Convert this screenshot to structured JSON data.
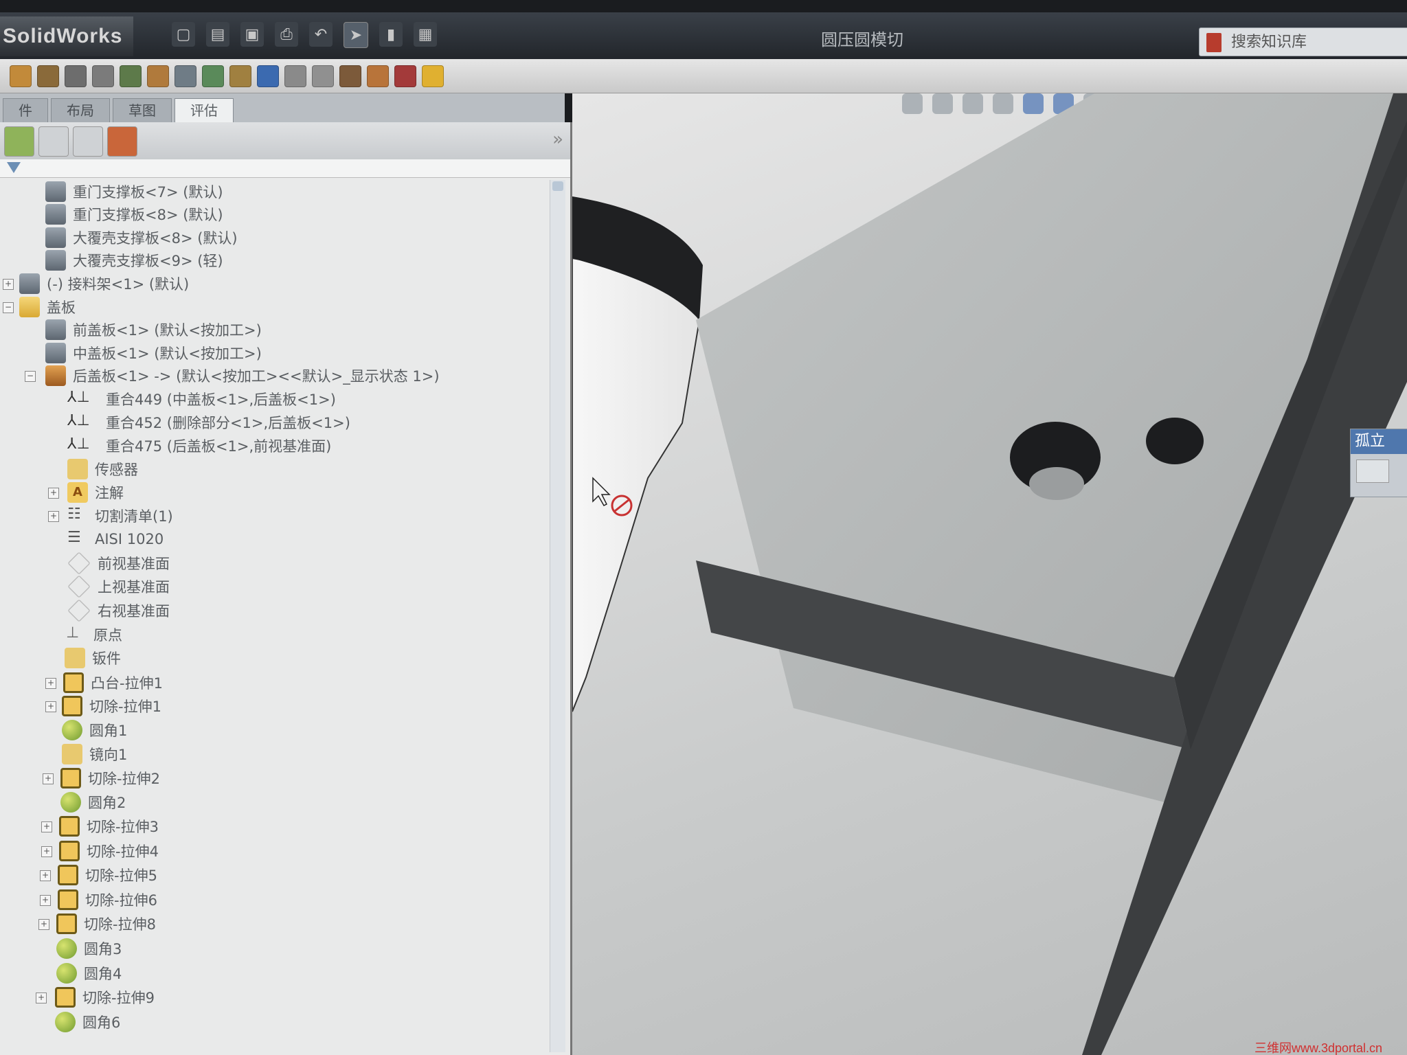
{
  "app": {
    "logo": "SolidWorks",
    "document_title": "圆压圆模切",
    "search_placeholder": "搜索知识库"
  },
  "tabs": [
    {
      "label": "件"
    },
    {
      "label": "布局"
    },
    {
      "label": "草图"
    },
    {
      "label": "评估"
    }
  ],
  "tree": [
    {
      "label": "重门支撑板<7> (默认)",
      "icon": "assembly-icon"
    },
    {
      "label": "重门支撑板<8> (默认)",
      "icon": "assembly-icon"
    },
    {
      "label": "大覆壳支撑板<8> (默认)",
      "icon": "assembly-icon"
    },
    {
      "label": "大覆壳支撑板<9> (轻)",
      "icon": "assembly-icon"
    },
    {
      "label": "(-) 接料架<1> (默认)",
      "icon": "assembly-icon"
    },
    {
      "label": "盖板",
      "icon": "folder-icon"
    },
    {
      "label": "前盖板<1> (默认<按加工>)",
      "icon": "assembly-icon"
    },
    {
      "label": "中盖板<1> (默认<按加工>)",
      "icon": "assembly-icon"
    },
    {
      "label": "后盖板<1> -> (默认<按加工><<默认>_显示状态 1>)",
      "icon": "part-icon"
    },
    {
      "label": "重合449 (中盖板<1>,后盖板<1>)",
      "icon": "mate-icon"
    },
    {
      "label": "重合452 (删除部分<1>,后盖板<1>)",
      "icon": "mate-icon"
    },
    {
      "label": "重合475 (后盖板<1>,前视基准面)",
      "icon": "mate-icon"
    },
    {
      "label": "传感器",
      "icon": "sensor-icon"
    },
    {
      "label": "注解",
      "icon": "annotation-icon"
    },
    {
      "label": "切割清单(1)",
      "icon": "cutlist-icon"
    },
    {
      "label": "AISI 1020",
      "icon": "material-icon"
    },
    {
      "label": "前视基准面",
      "icon": "plane-icon"
    },
    {
      "label": "上视基准面",
      "icon": "plane-icon"
    },
    {
      "label": "右视基准面",
      "icon": "plane-icon"
    },
    {
      "label": "原点",
      "icon": "origin-icon"
    },
    {
      "label": "钣件",
      "icon": "sheetmetal-icon"
    },
    {
      "label": "凸台-拉伸1",
      "icon": "extrude-icon"
    },
    {
      "label": "切除-拉伸1",
      "icon": "cut-extrude-icon"
    },
    {
      "label": "圆角1",
      "icon": "fillet-icon"
    },
    {
      "label": "镜向1",
      "icon": "mirror-icon"
    },
    {
      "label": "切除-拉伸2",
      "icon": "cut-extrude-icon"
    },
    {
      "label": "圆角2",
      "icon": "fillet-icon"
    },
    {
      "label": "切除-拉伸3",
      "icon": "cut-extrude-icon"
    },
    {
      "label": "切除-拉伸4",
      "icon": "cut-extrude-icon"
    },
    {
      "label": "切除-拉伸5",
      "icon": "cut-extrude-icon"
    },
    {
      "label": "切除-拉伸6",
      "icon": "cut-extrude-icon"
    },
    {
      "label": "切除-拉伸8",
      "icon": "cut-extrude-icon"
    },
    {
      "label": "圆角3",
      "icon": "fillet-icon"
    },
    {
      "label": "圆角4",
      "icon": "fillet-icon"
    },
    {
      "label": "切除-拉伸9",
      "icon": "cut-extrude-icon"
    },
    {
      "label": "圆角6",
      "icon": "fillet-icon"
    }
  ],
  "isolate": {
    "title": "孤立"
  },
  "watermark": "三维网www.3dportal.cn"
}
